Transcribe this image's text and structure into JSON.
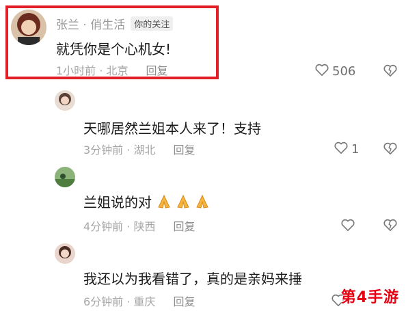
{
  "comments": [
    {
      "author": "张兰 · 俏生活",
      "tag": "你的关注",
      "text": "就凭你是个心机女!",
      "time_location": "1小时前 · 北京",
      "reply": "回复",
      "likes": "506"
    },
    {
      "author": "",
      "text": "天哪居然兰姐本人来了！支持",
      "time_location": "3分钟前 · 湖北",
      "reply": "回复",
      "likes": "1"
    },
    {
      "author": "",
      "text": "兰姐说的对",
      "time_location": "4分钟前 · 陕西",
      "reply": "回复",
      "likes": ""
    },
    {
      "author": "",
      "text": "我还以为我看错了，真的是亲妈来捶",
      "time_location": "6分钟前 · 重庆",
      "reply": "回复",
      "likes": ""
    }
  ],
  "watermark": "第4手游",
  "colors": {
    "highlight": "#e21f26",
    "watermark": "#e60012",
    "meta": "#a6a6a6"
  },
  "icons": {
    "like": "heart-outline-icon",
    "dislike": "broken-heart-icon",
    "emoji": "folded-hands-emoji"
  }
}
